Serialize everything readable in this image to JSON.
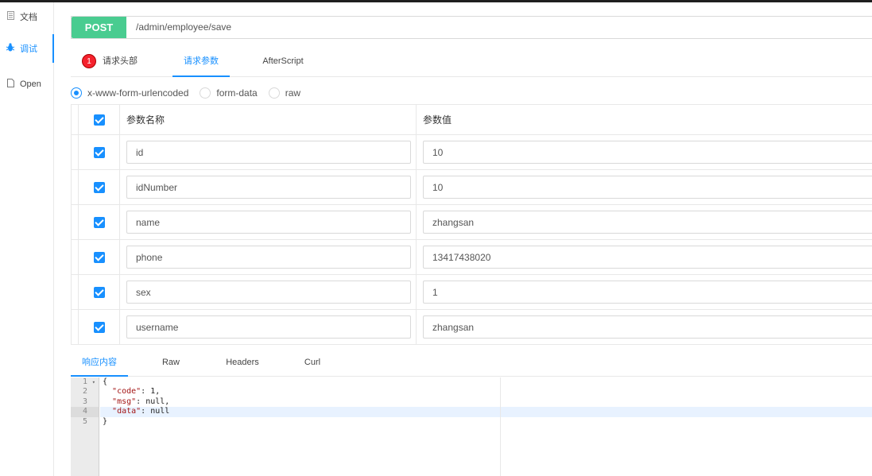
{
  "nav": {
    "items": [
      {
        "icon": "document-icon",
        "label": "文档"
      },
      {
        "icon": "bug-icon",
        "label": "调试",
        "active": true
      },
      {
        "icon": "file-icon",
        "label": "Open"
      }
    ]
  },
  "request": {
    "method": "POST",
    "url": "/admin/employee/save",
    "tabs": {
      "headers": {
        "label": "请求头部",
        "badge": "1"
      },
      "params": {
        "label": "请求参数"
      },
      "afterscript": {
        "label": "AfterScript"
      }
    },
    "body_types": [
      {
        "label": "x-www-form-urlencoded",
        "checked": true
      },
      {
        "label": "form-data",
        "checked": false
      },
      {
        "label": "raw",
        "checked": false
      }
    ],
    "table": {
      "col_name": "参数名称",
      "col_value": "参数值",
      "rows": [
        {
          "name": "id",
          "value": "10"
        },
        {
          "name": "idNumber",
          "value": "10"
        },
        {
          "name": "name",
          "value": "zhangsan"
        },
        {
          "name": "phone",
          "value": "13417438020"
        },
        {
          "name": "sex",
          "value": "1"
        },
        {
          "name": "username",
          "value": "zhangsan"
        }
      ]
    }
  },
  "response": {
    "tabs": [
      "响应内容",
      "Raw",
      "Headers",
      "Curl"
    ],
    "lines": [
      {
        "num": "1",
        "text": "{"
      },
      {
        "num": "2",
        "key": "\"code\"",
        "rest": ": 1,"
      },
      {
        "num": "3",
        "key": "\"msg\"",
        "rest": ": null,"
      },
      {
        "num": "4",
        "key": "\"data\"",
        "rest": ": null"
      },
      {
        "num": "5",
        "text": "}"
      }
    ]
  }
}
